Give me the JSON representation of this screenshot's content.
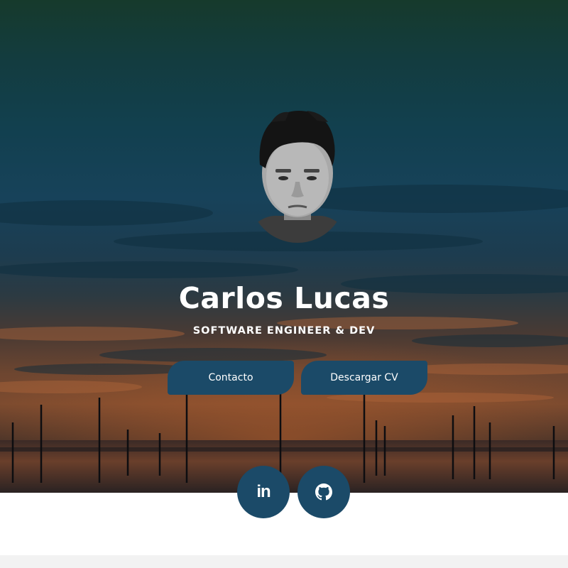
{
  "profile": {
    "name": "Carlos Lucas",
    "title": "SOFTWARE ENGINEER & DEV"
  },
  "actions": {
    "contact_label": "Contacto",
    "cv_label": "Descargar CV"
  },
  "social": [
    {
      "icon": "linkedin-icon",
      "glyph": "in"
    },
    {
      "icon": "github-icon"
    }
  ],
  "colors": {
    "accent": "#1b4a68",
    "text": "#ffffff",
    "page_background": "#ffffff"
  }
}
